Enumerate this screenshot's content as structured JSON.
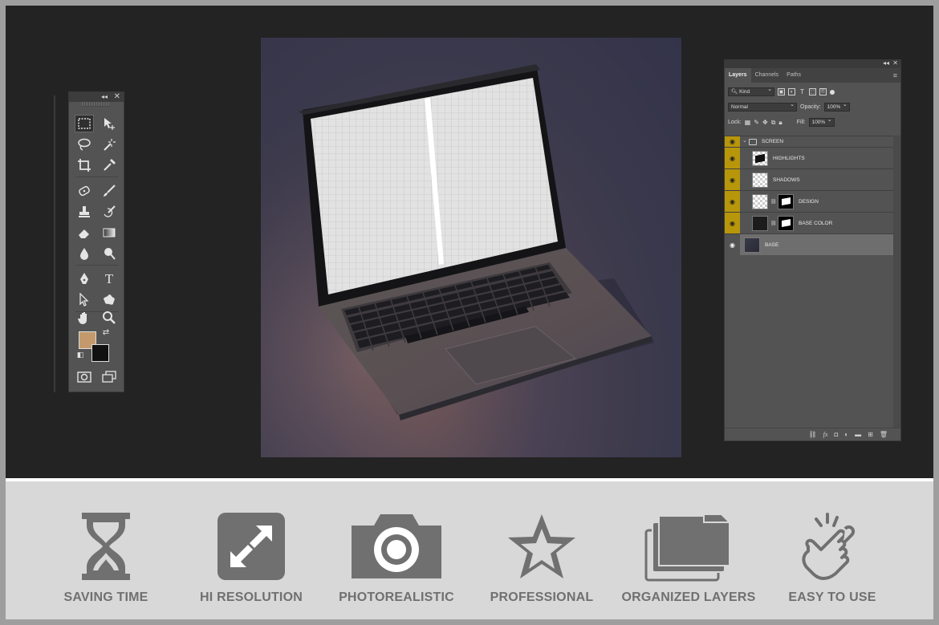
{
  "tools_panel": {
    "collapse_icon": "double-chevron-left-icon",
    "close_icon": "close-icon",
    "foreground_color": "#c49a6c",
    "background_color": "#111111"
  },
  "layers_panel": {
    "tabs": [
      {
        "label": "Layers",
        "active": true
      },
      {
        "label": "Channels",
        "active": false
      },
      {
        "label": "Paths",
        "active": false
      }
    ],
    "filter_kind": "Kind",
    "blend_mode": "Normal",
    "opacity_label": "Opacity:",
    "opacity_value": "100%",
    "lock_label": "Lock:",
    "fill_label": "Fill:",
    "fill_value": "100%",
    "layers": [
      {
        "name": "SCREEN",
        "type": "group"
      },
      {
        "name": "HIGHLIGHTS",
        "type": "layer"
      },
      {
        "name": "SHADOWS",
        "type": "layer"
      },
      {
        "name": "DESIGN",
        "type": "smart-masked"
      },
      {
        "name": "BASE COLOR",
        "type": "masked"
      },
      {
        "name": "BASE",
        "type": "photo",
        "selected": true
      }
    ],
    "highlight_color": "#b8960a"
  },
  "features": [
    {
      "label": "SAVING TIME",
      "icon": "hourglass-icon"
    },
    {
      "label": "HI RESOLUTION",
      "icon": "expand-arrows-icon"
    },
    {
      "label": "PHOTOREALISTIC",
      "icon": "camera-icon"
    },
    {
      "label": "PROFESSIONAL",
      "icon": "star-icon"
    },
    {
      "label": "ORGANIZED LAYERS",
      "icon": "folders-icon"
    },
    {
      "label": "EASY TO USE",
      "icon": "tap-hand-icon"
    }
  ],
  "colors": {
    "workspace": "#232323",
    "panel": "#535353",
    "feature_bg": "#d8d8d8",
    "feature_icon": "#707070"
  }
}
